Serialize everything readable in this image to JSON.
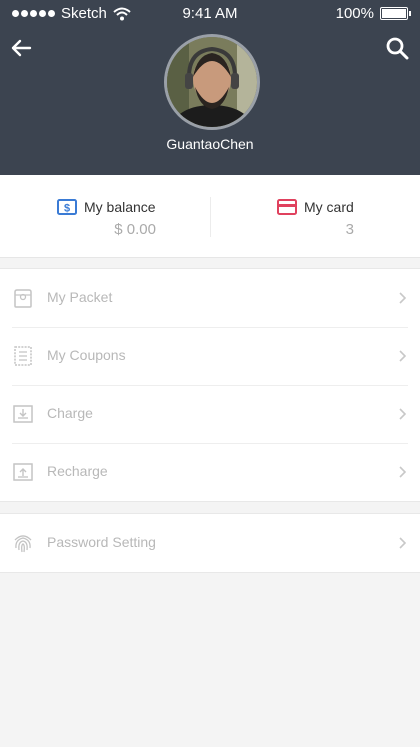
{
  "status_bar": {
    "carrier": "Sketch",
    "time": "9:41 AM",
    "battery": "100%"
  },
  "header": {
    "back_icon": "arrow-left-icon",
    "search_icon": "search-icon",
    "username": "GuantaoChen"
  },
  "balance": {
    "label": "My balance",
    "value": "$ 0.00",
    "icon": "dollar-icon",
    "icon_color": "#3a7bd5"
  },
  "card": {
    "label": "My card",
    "value": "3",
    "icon": "credit-card-icon",
    "icon_color": "#e0415e"
  },
  "menu": {
    "items": [
      {
        "label": "My Packet",
        "icon": "packet-icon"
      },
      {
        "label": "My Coupons",
        "icon": "coupon-icon"
      },
      {
        "label": "Charge",
        "icon": "charge-icon"
      },
      {
        "label": "Recharge",
        "icon": "recharge-icon"
      }
    ],
    "settings": [
      {
        "label": "Password Setting",
        "icon": "fingerprint-icon"
      }
    ]
  },
  "colors": {
    "header_bg": "#3c4450",
    "page_bg": "#f4f4f4",
    "muted_text": "#b8b8b8"
  }
}
